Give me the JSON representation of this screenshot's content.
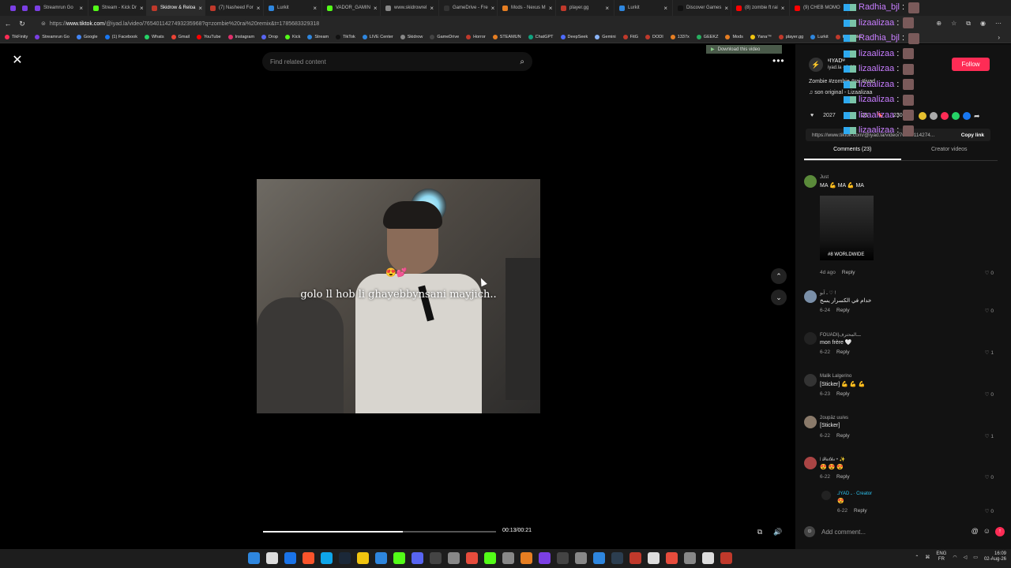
{
  "browser": {
    "tabs": [
      {
        "label": "Streamrun Go",
        "color": "#7b3fe4"
      },
      {
        "label": "Stream - Kick Dr",
        "color": "#53fc18"
      },
      {
        "label": "Skidrow & Reloa",
        "color": "#c0392b",
        "active": true
      },
      {
        "label": "(7) Nasheed For",
        "color": "#c0392b"
      },
      {
        "label": "Lurkit",
        "color": "#2e86de"
      },
      {
        "label": "VADOR_GAMIN",
        "color": "#53fc18"
      },
      {
        "label": "www.skidrowrel",
        "color": "#888888"
      },
      {
        "label": "GameDrive - Fre",
        "color": "#333333"
      },
      {
        "label": "Mods - Nexus M",
        "color": "#e67e22"
      },
      {
        "label": "player.gg",
        "color": "#c0392b"
      },
      {
        "label": "Lurkit",
        "color": "#2e86de"
      },
      {
        "label": "Discover Games",
        "color": "#111111"
      },
      {
        "label": "(8) zombie ft rai",
        "color": "#ff0000"
      },
      {
        "label": "(9) CHEB MOMO",
        "color": "#ff0000"
      }
    ],
    "url_prefix": "https://",
    "url_host": "www.tiktok.com",
    "url_rest": "/@iyad.la/video/7654011427493235968?q=zombie%20rai%20remix&t=1785683329318",
    "bookmarks": [
      "TikFinity",
      "Streamrun Go",
      "Google",
      "(1) Facebook",
      "Whats",
      "Gmail",
      "YouTube",
      "Instagram",
      "Drop",
      "Kick",
      "Stream",
      "TikTok",
      "LIVE Center",
      "Skidrow",
      "GameDrive",
      "Horror",
      "STEAMUN",
      "ChatGPT",
      "DeepSeek",
      "Gemini",
      "FitG",
      "DODI",
      "1337x",
      "GEEKZ",
      "Mods",
      "Yana™",
      "player.gg",
      "Lurkit",
      "Keymailer"
    ]
  },
  "viewer": {
    "search_placeholder": "Find related content",
    "download_label": "Download this video",
    "caption": "golo ll hob li ghayebbynsani mayjich..",
    "emoji": "😍💕",
    "time": "00:13/00:21",
    "progress": 0.6
  },
  "panel": {
    "creator_name": "ʶIYADʷ",
    "creator_sub": "iyad.la · 6-22",
    "follow_label": "Follow",
    "description": "Zombie #zombie #rai #iyad",
    "sound": "son original - Lizaalizaa",
    "likes": "2027",
    "comments_count": "23",
    "saves": "230",
    "link": "https://www.tiktok.com/@iyad.la/video/76540114274...",
    "copy_label": "Copy link",
    "tab_comments": "Comments (23)",
    "tab_creator": "Creator videos",
    "add_comment_placeholder": "Add comment..."
  },
  "overlay_chat": [
    {
      "user": "Radhia_bjl",
      "text": ":"
    },
    {
      "user": "lizaalizaa",
      "text": ":"
    },
    {
      "user": "Radhia_bjl",
      "text": ":"
    },
    {
      "user": "lizaalizaa",
      "text": ":"
    },
    {
      "user": "lizaalizaa",
      "text": ":"
    },
    {
      "user": "lizaalizaa",
      "text": ":"
    },
    {
      "user": "lizaalizaa",
      "text": ":"
    },
    {
      "user": "lizaalizaa",
      "text": ":"
    },
    {
      "user": "lizaalizaa",
      "text": ":"
    }
  ],
  "comments": [
    {
      "name": "Just",
      "text": "MA 💪 MA 💪 MA",
      "meta": "4d ago",
      "reply": "Reply",
      "likes": "0"
    },
    {
      "name": "ـ ﺁﺑﻮ ♡ ! ",
      "text": "خدام في الكسرار يسخ",
      "meta": "6-24",
      "reply": "Reply",
      "likes": "0"
    },
    {
      "name": "FOUADI|ـــالمحترف",
      "text": "mon frère 🤍",
      "meta": "6-22",
      "reply": "Reply",
      "likes": "1"
    },
    {
      "name": "Malik Lalgerino",
      "text": "[Sticker] 💪 💪 💪",
      "meta": "6-23",
      "reply": "Reply",
      "likes": "0"
    },
    {
      "name": "2oupāz uu/es",
      "text": "[Sticker]",
      "meta": "6-22",
      "reply": "Reply",
      "likes": "1"
    },
    {
      "name": "l 𝓕𝓪𝓽𝓱𝓲 • ✨",
      "text": "😍 😍 😍",
      "meta": "6-22",
      "reply": "Reply",
      "likes": "0"
    },
    {
      "name": "ـIYAD ـ · Creator",
      "text": "😍",
      "meta": "6-22",
      "reply": "Reply",
      "likes": "0"
    }
  ],
  "thumb_text": "#8 WORLDWIDE",
  "taskbar": {
    "lang_top": "ENG",
    "lang_bottom": "FR",
    "time": "16:09",
    "date": "02-Aug-26"
  }
}
